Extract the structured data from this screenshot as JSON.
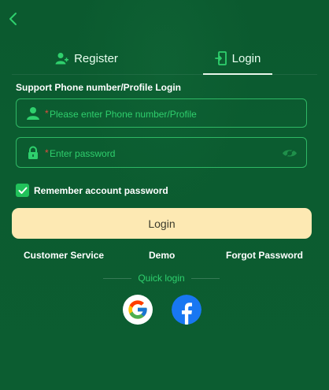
{
  "tabs": [
    {
      "label": "Register",
      "active": false,
      "icon": "user-add-icon"
    },
    {
      "label": "Login",
      "active": true,
      "icon": "login-door-icon"
    }
  ],
  "form": {
    "section_label": "Support Phone number/Profile Login",
    "phone": {
      "required_mark": "*",
      "placeholder": "Please enter Phone number/Profile",
      "value": "",
      "icon": "user-icon"
    },
    "password": {
      "required_mark": "*",
      "placeholder": "Enter password",
      "value": "",
      "icon": "lock-icon",
      "toggle_icon": "eye-icon"
    },
    "remember": {
      "label": "Remember account password",
      "checked": true
    },
    "submit_label": "Login"
  },
  "links": {
    "customer_service": "Customer Service",
    "demo": "Demo",
    "forgot_password": "Forgot Password"
  },
  "quick_login": {
    "label": "Quick login",
    "providers": [
      "google-icon",
      "facebook-icon"
    ]
  },
  "colors": {
    "background": "#0b5c30",
    "accent": "#2fcf6d",
    "button": "#fde9b3",
    "required": "#e04b3f"
  }
}
